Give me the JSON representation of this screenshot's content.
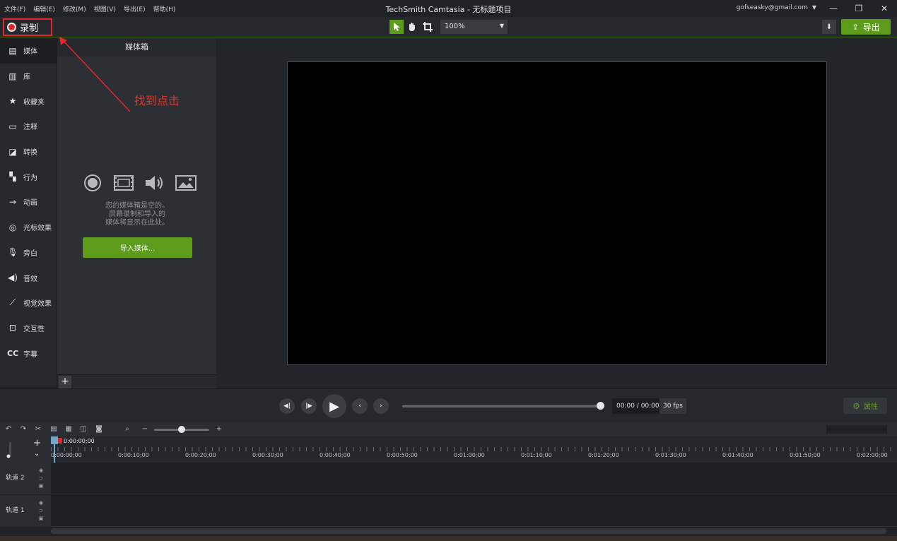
{
  "menu": [
    "文件(F)",
    "编辑(E)",
    "修改(M)",
    "视图(V)",
    "导出(E)",
    "帮助(H)"
  ],
  "app_title": "TechSmith Camtasia - 无标题项目",
  "account": "gofseasky@gmail.com",
  "toolbar": {
    "record_label": "录制",
    "zoom_value": "100%",
    "export_label": "导出"
  },
  "nav": [
    {
      "label": "媒体",
      "icon": "film-strip-icon"
    },
    {
      "label": "库",
      "icon": "library-icon"
    },
    {
      "label": "收藏夹",
      "icon": "star-icon"
    },
    {
      "label": "注释",
      "icon": "annotation-icon"
    },
    {
      "label": "转换",
      "icon": "transition-icon"
    },
    {
      "label": "行为",
      "icon": "behavior-icon"
    },
    {
      "label": "动画",
      "icon": "animation-icon"
    },
    {
      "label": "光标效果",
      "icon": "cursor-effect-icon"
    },
    {
      "label": "旁白",
      "icon": "microphone-icon"
    },
    {
      "label": "音效",
      "icon": "speaker-icon"
    },
    {
      "label": "视觉效果",
      "icon": "magic-wand-icon"
    },
    {
      "label": "交互性",
      "icon": "interactive-icon"
    },
    {
      "label": "字幕",
      "icon": "captions-icon"
    }
  ],
  "media_bin": {
    "title": "媒体箱",
    "empty_line1": "您的媒体箱是空的。",
    "empty_line2": "屏幕录制和导入的",
    "empty_line3": "媒体将显示在此处。",
    "import_label": "导入媒体..."
  },
  "annotation": "找到点击",
  "playback": {
    "timecode": "00:00 / 00:00",
    "fps": "30 fps",
    "properties_label": "属性"
  },
  "timeline": {
    "playhead_time": "0:00:00;00",
    "ticks": [
      "0:00:00;00",
      "0:00:10;00",
      "0:00:20;00",
      "0:00:30;00",
      "0:00:40;00",
      "0:00:50;00",
      "0:01:00;00",
      "0:01:10;00",
      "0:01:20;00",
      "0:01:30;00",
      "0:01:40;00",
      "0:01:50;00",
      "0:02:00;00"
    ],
    "tracks": [
      "轨道 2",
      "轨道 1"
    ]
  },
  "colors": {
    "accent_green": "#5d9b1a",
    "annotation_red": "#e3292c"
  }
}
